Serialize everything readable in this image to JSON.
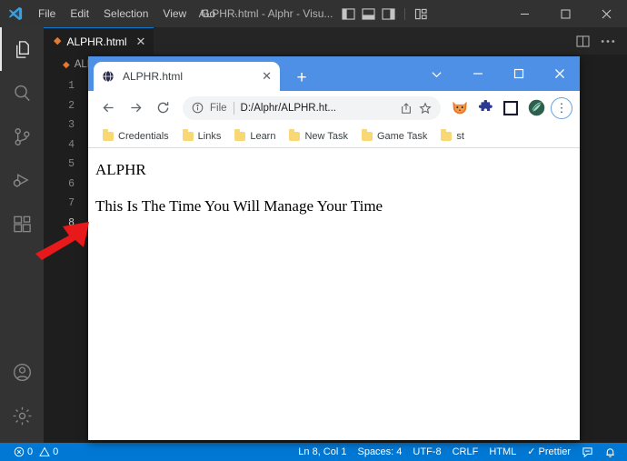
{
  "vscode": {
    "menu": [
      "File",
      "Edit",
      "Selection",
      "View",
      "Go",
      "···"
    ],
    "window_title": "ALPHR.html - Alphr - Visu...",
    "layout_icons": [
      "toggle-primary-sidebar-icon",
      "toggle-panel-icon",
      "toggle-secondary-sidebar-icon",
      "customize-layout-icon"
    ],
    "window_controls": [
      "minimize",
      "maximize",
      "close"
    ],
    "activity_bar": [
      {
        "name": "explorer",
        "label": "Explorer"
      },
      {
        "name": "search",
        "label": "Search"
      },
      {
        "name": "source-control",
        "label": "Source Control"
      },
      {
        "name": "run-debug",
        "label": "Run and Debug"
      },
      {
        "name": "extensions",
        "label": "Extensions"
      },
      {
        "name": "account",
        "label": "Accounts"
      },
      {
        "name": "settings",
        "label": "Manage"
      }
    ],
    "tab": {
      "label": "ALPHR.html",
      "icon": "html-file-icon",
      "close": "✕"
    },
    "tab_actions": [
      "split-editor-icon",
      "more-actions-icon"
    ],
    "breadcrumb": "ALPHR.html",
    "line_numbers": [
      "1",
      "2",
      "3",
      "4",
      "5",
      "6",
      "7",
      "8"
    ],
    "current_line": "8",
    "status_bar": {
      "errors": "0",
      "warnings": "0",
      "position": "Ln 8, Col 1",
      "indentation": "Spaces: 4",
      "encoding": "UTF-8",
      "eol": "CRLF",
      "language": "HTML",
      "formatter": "✓ Prettier",
      "right_icons": [
        "remote-feedback-icon",
        "notifications-bell-icon"
      ]
    }
  },
  "browser": {
    "tab": {
      "title": "ALPHR.html",
      "favicon": "globe-icon",
      "close": "✕"
    },
    "new_tab": "+",
    "window_controls": [
      "tab-search-chevron",
      "minimize",
      "maximize",
      "close"
    ],
    "nav": {
      "back": "←",
      "forward": "→",
      "reload": "↻"
    },
    "omnibox": {
      "info_icon": "info-circle-icon",
      "scheme": "File",
      "url": "D:/Alphr/ALPHR.ht...",
      "share_icon": "share-icon",
      "star_icon": "bookmark-star-icon"
    },
    "extensions": [
      "fox-extension-icon",
      "puzzle-extensions-icon",
      "square-extension-icon",
      "profile-avatar-icon"
    ],
    "menu_button": "⋮",
    "bookmarks": [
      "Credentials",
      "Links",
      "Learn",
      "New Task",
      "Game Task",
      "st"
    ],
    "page": {
      "heading": "ALPHR",
      "paragraph": "This Is The Time You Will Manage Your Time"
    }
  },
  "annotation": {
    "arrow": "red-arrow-pointer",
    "color": "#e8191b"
  },
  "colors": {
    "vscode_titlebar": "#323233",
    "vscode_activitybar": "#333333",
    "vscode_editor": "#1e1e1e",
    "statusbar_blue": "#0078d4",
    "chrome_tabstrip": "#4d90e5",
    "html_icon_orange": "#e37933",
    "bookmark_yellow": "#f8d775"
  }
}
